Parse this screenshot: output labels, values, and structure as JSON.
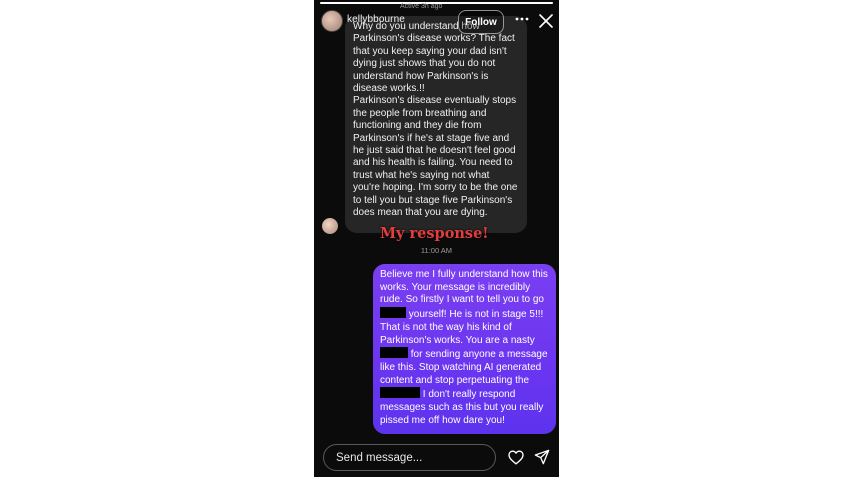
{
  "story": {
    "progress": 1.0
  },
  "header": {
    "username": "kellybbourne",
    "active_status": "Active 3h ago",
    "follow_label": "Follow",
    "more_icon": "more-horizontal-icon",
    "close_icon": "close-icon"
  },
  "conversation": {
    "received_message": "Why do you understand how Parkinson's disease works? The fact that you keep saying your dad isn't dying just shows that you do not understand how Parkinson's is disease works.!!\nParkinson's disease eventually stops the people from breathing and functioning and they die from Parkinson's if he's at stage five and he just said that he doesn't feel good and his health is failing. You need to trust what he's saying not what you're hoping. I'm sorry to be the one to tell you but stage five Parkinson's does mean that you are dying.",
    "overlay_caption": "My response!",
    "timestamp": "11:00 AM",
    "sent_message": {
      "part1": "Believe me I fully understand how this works. Your message is incredibly rude. So firstly I want to tell you to go",
      "part2": "yourself! He is not in stage 5!!! That is not the way his kind of Parkinson's works. You are a nasty",
      "part3": "for sending anyone a message like this. Stop watching AI generated content and stop perpetuating the",
      "part4": "I don't really respond messages such as this but you really pissed me off how dare you!"
    },
    "sent_bubble_color": "#6b35f0"
  },
  "composer": {
    "placeholder": "Send message...",
    "heart_icon": "heart-icon",
    "send_icon": "send-icon"
  }
}
